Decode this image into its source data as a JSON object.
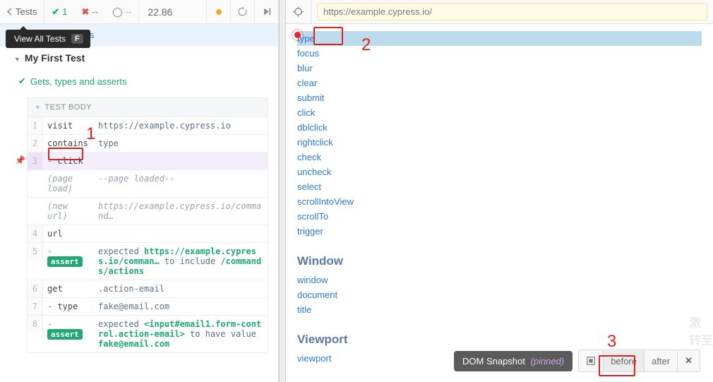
{
  "topbar": {
    "back_label": "Tests",
    "passed": "1",
    "failed": "--",
    "pending": "--",
    "time": "22.86"
  },
  "tooltip": {
    "text": "View All Tests",
    "key": "F"
  },
  "spec_path": "ation/sample_spec.js",
  "suite": {
    "name": "My First Test"
  },
  "test": {
    "name": "Gets, types and asserts"
  },
  "test_body_label": "TEST BODY",
  "log_rows": [
    {
      "n": "1",
      "cmd": "visit",
      "msg": "https://example.cypress.io"
    },
    {
      "n": "2",
      "cmd": "contains",
      "msg": "type"
    },
    {
      "n": "3",
      "cmd": "-click",
      "msg": "",
      "highlight": true
    },
    {
      "n": "",
      "cmd": "(page load)",
      "msg": "--page loaded--",
      "info": true
    },
    {
      "n": "",
      "cmd": "(new url)",
      "msg": "https://example.cypress.io/command…",
      "info": true
    },
    {
      "n": "4",
      "cmd": "url",
      "msg": ""
    },
    {
      "n": "5",
      "cmd": "-assert",
      "msg_parts": [
        "expected ",
        "https://example.cypress.io/comman…",
        " to include ",
        "/commands/actions"
      ],
      "assert": true
    },
    {
      "n": "6",
      "cmd": "get",
      "msg": ".action-email"
    },
    {
      "n": "7",
      "cmd": "-type",
      "msg": "fake@email.com"
    },
    {
      "n": "8",
      "cmd": "-assert",
      "msg_parts": [
        "expected ",
        "<input#email1.form-control.action-email>",
        " to have value ",
        "fake@email.com"
      ],
      "assert": true
    }
  ],
  "address_url": "https://example.cypress.io/",
  "preview": {
    "type_link": "type",
    "actions": [
      "focus",
      "blur",
      "clear",
      "submit",
      "click",
      "dblclick",
      "rightclick",
      "check",
      "uncheck",
      "select",
      "scrollIntoView",
      "scrollTo",
      "trigger"
    ],
    "window_title": "Window",
    "window_items": [
      "window",
      "document",
      "title"
    ],
    "viewport_title": "Viewport",
    "viewport_items": [
      "viewport"
    ]
  },
  "snapshot": {
    "label": "DOM Snapshot",
    "pinned": "(pinned)",
    "before": "before",
    "after": "after"
  },
  "annotations": {
    "one": "1",
    "two": "2",
    "three": "3"
  },
  "watermark": {
    "l1": "激",
    "l2": "转至"
  }
}
